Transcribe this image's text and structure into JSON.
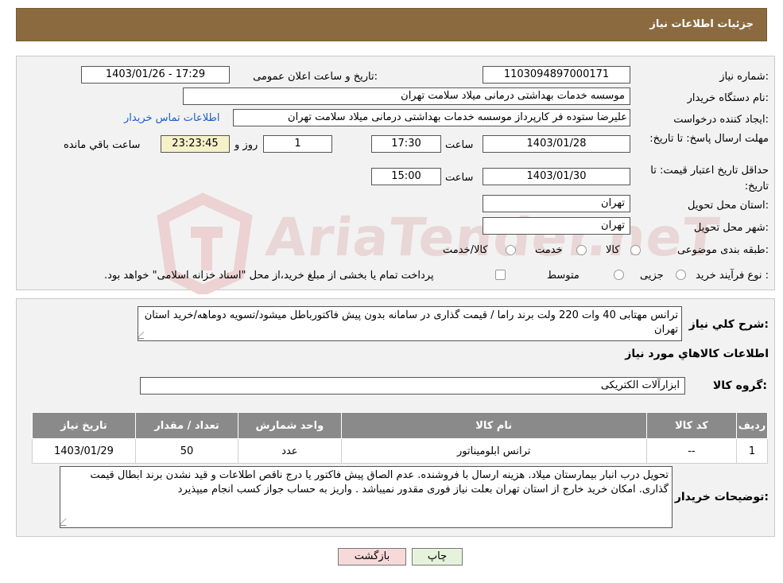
{
  "header": {
    "title": "جزئیات اطلاعات نیاز"
  },
  "form": {
    "need_number_label": "شماره نیاز:",
    "need_number": "1103094897000171",
    "announce_label": "تاریخ و ساعت اعلان عمومی:",
    "announce_value": "1403/01/26 - 17:29",
    "buyer_org_label": "نام دستگاه خریدار:",
    "buyer_org": "موسسه خدمات بهداشتی درمانی میلاد سلامت تهران",
    "creator_label": "ایجاد کننده درخواست:",
    "creator": "علیرضا ستوده فر کارپرداز موسسه خدمات بهداشتی درمانی میلاد سلامت تهران",
    "buyer_contact_link": "اطلاعات تماس خریدار",
    "reply_deadline_label": "مهلت ارسال پاسخ: تا تاریخ:",
    "reply_date": "1403/01/28",
    "time_label": "ساعت",
    "reply_time": "17:30",
    "days_value": "1",
    "day_and_label": "روز و",
    "remaining_time": "23:23:45",
    "remaining_label": "ساعت باقي مانده",
    "price_validity_label": "حداقل تاریخ اعتبار قیمت: تا تاریخ:",
    "price_date": "1403/01/30",
    "price_time": "15:00",
    "province_label": "استان محل تحویل:",
    "province": "تهران",
    "city_label": "شهر محل تحویل:",
    "city": "تهران",
    "category_label": "طبقه بندی موضوعی:",
    "category_options": [
      "کالا",
      "خدمت",
      "کالا/خدمت"
    ],
    "process_label": "نوع فرآیند خرید :",
    "process_options": [
      "جزیی",
      "متوسط"
    ],
    "process_note": "پرداخت تمام یا بخشی از مبلغ خرید،از محل \"اسناد خزانه اسلامی\" خواهد بود."
  },
  "summary": {
    "label": "شرح کلي نياز:",
    "text": "ترانس مهتابی 40 وات 220 ولت برند راما / قیمت گذاری در سامانه بدون پیش فاکتورباطل میشود/تسویه دوماهه/خرید استان تهران",
    "goods_info_title": "اطلاعات کالاهاي مورد نياز",
    "group_label": "گروه کالا:",
    "group_value": "ابزارآلات الکتریکی"
  },
  "table": {
    "columns": [
      "رديف",
      "کد کالا",
      "نام کالا",
      "واحد شمارش",
      "تعداد / مقدار",
      "تاریخ نیاز"
    ],
    "rows": [
      [
        "1",
        "--",
        "ترانس ابلومیناتور",
        "عدد",
        "50",
        "1403/01/29"
      ]
    ]
  },
  "buyer_notes": {
    "label": "توضیحات خریدار:",
    "text": "تحویل درب انبار بیمارستان میلاد. هزینه ارسال با فروشنده. عدم الصاق پیش فاکتور یا درج ناقص اطلاعات و قید نشدن برند ابطال قیمت گذاری. امکان خرید خارج از استان تهران بعلت نیاز فوری مقدور نمیباشد . واریز به حساب جواز کسب انجام میپذیرد"
  },
  "buttons": {
    "print": "چاپ",
    "back": "بازگشت"
  },
  "watermark": {
    "text": "AriaTender.neT"
  },
  "colors": {
    "header_bg": "#8c6a40",
    "table_header_bg": "#8a8a8a",
    "back_button_bg": "#f7d9d9",
    "print_button_bg": "#e6f3dc",
    "link": "#1a5dc9",
    "remaining_bg": "#f6f1c8"
  }
}
